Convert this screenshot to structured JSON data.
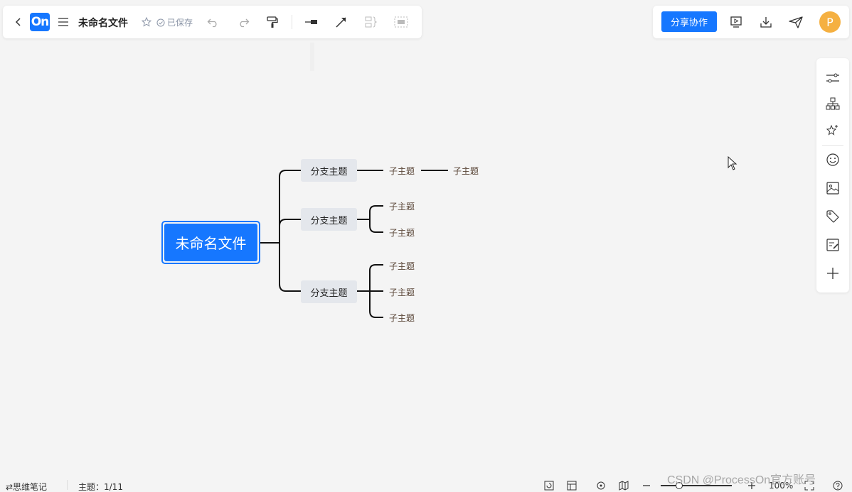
{
  "toolbar": {
    "logo_text": "On",
    "doc_title": "未命名文件",
    "saved_status": "已保存",
    "share_label": "分享协作",
    "avatar_letter": "P"
  },
  "mindmap": {
    "root": "未命名文件",
    "branches": [
      {
        "label": "分支主题",
        "children": [
          "子主题"
        ],
        "grandchild": "子主题"
      },
      {
        "label": "分支主题",
        "children": [
          "子主题",
          "子主题"
        ]
      },
      {
        "label": "分支主题",
        "children": [
          "子主题",
          "子主题",
          "子主题"
        ]
      }
    ]
  },
  "statusbar": {
    "mode_label": "⇄思维笔记",
    "topic_count": "主题：1/11",
    "zoom_level": "100%"
  },
  "watermark": "CSDN @ProcessOn官方账号",
  "colors": {
    "accent": "#1677ff",
    "canvas_bg": "#f4f4f4",
    "branch_bg": "#e4e7ec",
    "avatar": "#f5b041",
    "subtopic_text": "#5a4638"
  }
}
